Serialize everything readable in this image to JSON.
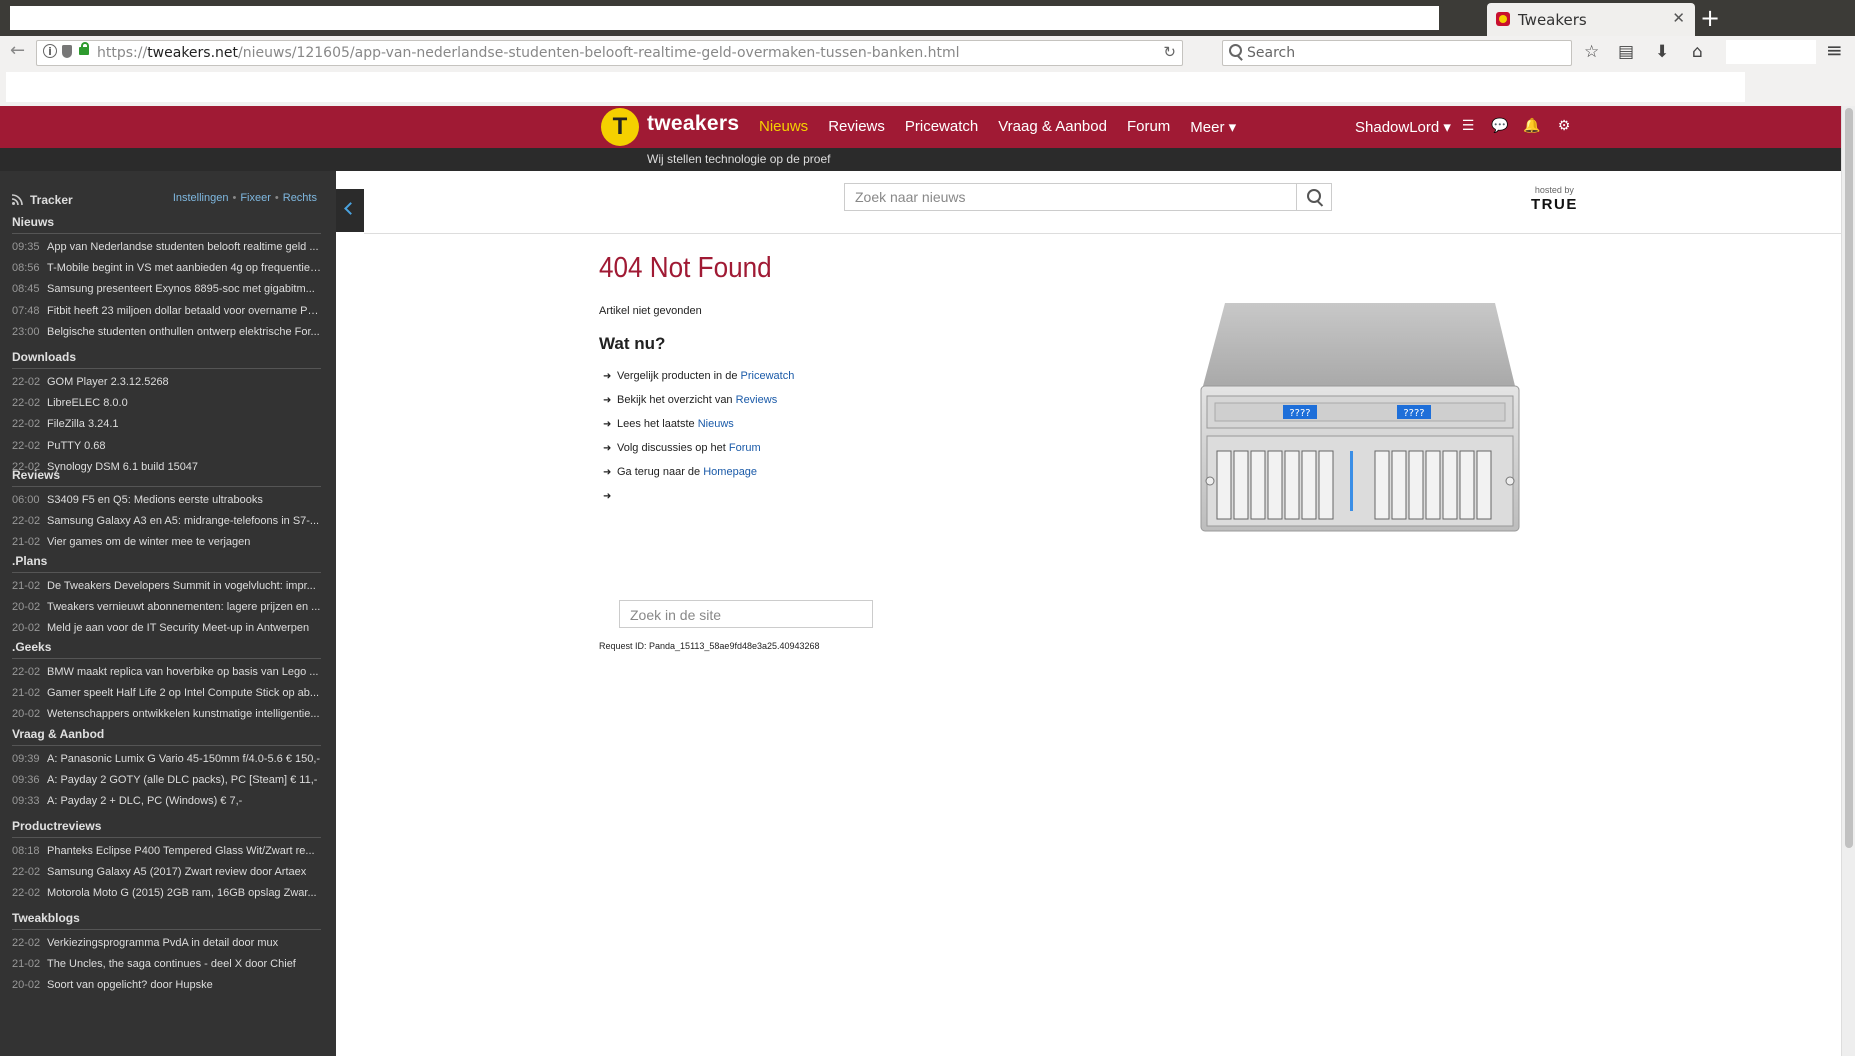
{
  "browser": {
    "tab_title": "Tweakers",
    "tab_close": "✕",
    "new_tab": "+",
    "url_host": "tweakers.net",
    "url_prefix": "https://",
    "url_path": "/nieuws/121605/app-van-nederlandse-studenten-belooft-realtime-geld-overmaken-tussen-banken.html",
    "search_placeholder": "Search"
  },
  "header": {
    "logo_text": "tweakers",
    "nav": [
      "Nieuws",
      "Reviews",
      "Pricewatch",
      "Vraag & Aanbod",
      "Forum",
      "Meer ▾"
    ],
    "active_nav": "Nieuws",
    "user": "ShadowLord ▾",
    "tagline": "Wij stellen technologie op de proef"
  },
  "tracker": {
    "title": "Tracker",
    "links": [
      "Instellingen",
      "Fixeer",
      "Rechts"
    ],
    "sections": [
      {
        "title": "Nieuws",
        "items": [
          {
            "time": "09:35",
            "text": "App van Nederlandse studenten belooft realtime geld ..."
          },
          {
            "time": "08:56",
            "text": "T-Mobile begint in VS met aanbieden 4g op frequentie ..."
          },
          {
            "time": "08:45",
            "text": "Samsung presenteert Exynos 8895-soc met gigabitm..."
          },
          {
            "time": "07:48",
            "text": "Fitbit heeft 23 miljoen dollar betaald voor overname Pe..."
          },
          {
            "time": "23:00",
            "text": "Belgische studenten onthullen ontwerp elektrische For..."
          }
        ]
      },
      {
        "title": "Downloads",
        "items": [
          {
            "time": "22-02",
            "text": "GOM Player 2.3.12.5268"
          },
          {
            "time": "22-02",
            "text": "LibreELEC 8.0.0"
          },
          {
            "time": "22-02",
            "text": "FileZilla 3.24.1"
          },
          {
            "time": "22-02",
            "text": "PuTTY 0.68"
          },
          {
            "time": "22-02",
            "text": "Synology DSM 6.1 build 15047"
          }
        ]
      },
      {
        "title": "Reviews",
        "items": [
          {
            "time": "06:00",
            "text": "S3409 F5 en Q5: Medions eerste ultrabooks"
          },
          {
            "time": "22-02",
            "text": "Samsung Galaxy A3 en A5: midrange-telefoons in S7-..."
          },
          {
            "time": "21-02",
            "text": "Vier games om de winter mee te verjagen"
          }
        ]
      },
      {
        "title": ".Plans",
        "items": [
          {
            "time": "21-02",
            "text": "De Tweakers Developers Summit in vogelvlucht: impr..."
          },
          {
            "time": "20-02",
            "text": "Tweakers vernieuwt abonnementen: lagere prijzen en ..."
          },
          {
            "time": "20-02",
            "text": "Meld je aan voor de IT Security Meet-up in Antwerpen"
          }
        ]
      },
      {
        "title": ".Geeks",
        "items": [
          {
            "time": "22-02",
            "text": "BMW maakt replica van hoverbike op basis van Lego ..."
          },
          {
            "time": "21-02",
            "text": "Gamer speelt Half Life 2 op Intel Compute Stick op ab..."
          },
          {
            "time": "20-02",
            "text": "Wetenschappers ontwikkelen kunstmatige intelligentie..."
          }
        ]
      },
      {
        "title": "Vraag & Aanbod",
        "items": [
          {
            "time": "09:39",
            "text": "A: Panasonic Lumix G Vario 45-150mm f/4.0-5.6 € 150,-"
          },
          {
            "time": "09:36",
            "text": "A: Payday 2 GOTY (alle DLC packs), PC [Steam] € 11,-"
          },
          {
            "time": "09:33",
            "text": "A: Payday 2 + DLC, PC (Windows) € 7,-"
          }
        ]
      },
      {
        "title": "Productreviews",
        "items": [
          {
            "time": "08:18",
            "text": "Phanteks Eclipse P400 Tempered Glass Wit/Zwart re..."
          },
          {
            "time": "22-02",
            "text": "Samsung Galaxy A5 (2017) Zwart review door Artaex"
          },
          {
            "time": "22-02",
            "text": "Motorola Moto G (2015) 2GB ram, 16GB opslag Zwar..."
          }
        ]
      },
      {
        "title": "Tweakblogs",
        "items": [
          {
            "time": "22-02",
            "text": "Verkiezingsprogramma PvdA in detail door mux"
          },
          {
            "time": "21-02",
            "text": "The Uncles, the saga continues - deel X door Chief"
          },
          {
            "time": "20-02",
            "text": "Soort van opgelicht? door Hupske"
          }
        ]
      }
    ]
  },
  "content": {
    "news_search_placeholder": "Zoek naar nieuws",
    "hosted_label": "hosted by",
    "hosted_brand": "TRUE",
    "title": "404 Not Found",
    "subtitle": "Artikel niet gevonden",
    "heading": "Wat nu?",
    "options": [
      {
        "prefix": "Vergelijk producten in de ",
        "link": "Pricewatch"
      },
      {
        "prefix": "Bekijk het overzicht van ",
        "link": "Reviews"
      },
      {
        "prefix": "Lees het laatste ",
        "link": "Nieuws"
      },
      {
        "prefix": "Volg discussies op het ",
        "link": "Forum"
      },
      {
        "prefix": "Ga terug naar de ",
        "link": "Homepage"
      }
    ],
    "site_search_placeholder": "Zoek in de site",
    "request_id": "Request ID: Panda_15113_58ae9fd48e3a25.40943268",
    "server_display_text": "????"
  }
}
